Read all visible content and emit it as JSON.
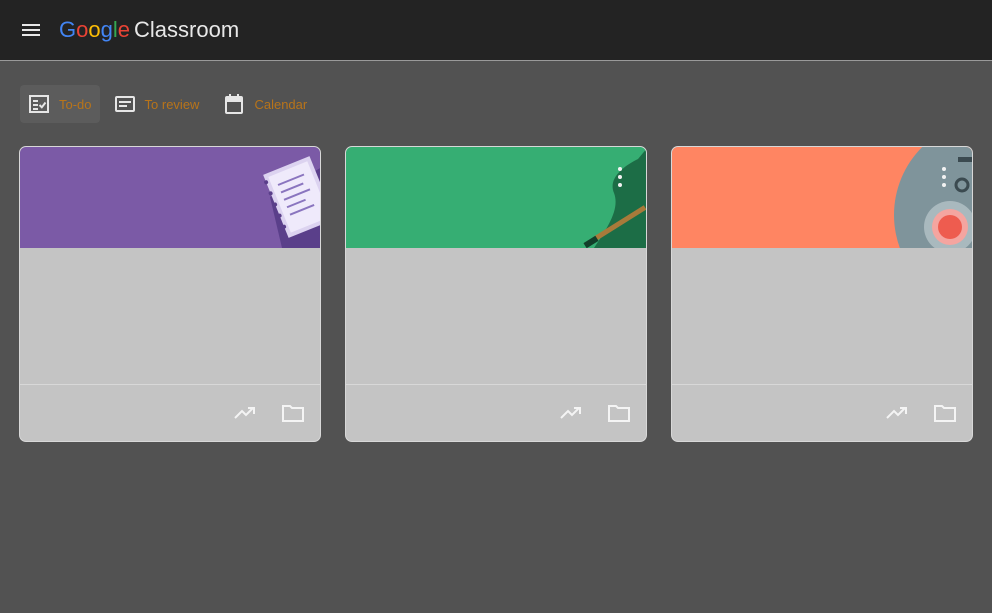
{
  "header": {
    "menu_icon": "hamburger-menu-icon",
    "brand": {
      "google_letters": [
        {
          "char": "G",
          "color": "#4285f4"
        },
        {
          "char": "o",
          "color": "#ea4335"
        },
        {
          "char": "o",
          "color": "#fbbc05"
        },
        {
          "char": "g",
          "color": "#4285f4"
        },
        {
          "char": "l",
          "color": "#34a853"
        },
        {
          "char": "e",
          "color": "#ea4335"
        }
      ],
      "product": "Classroom"
    }
  },
  "toolbar": {
    "todo_label": "To-do",
    "review_label": "To review",
    "calendar_label": "Calendar",
    "accent_color": "#b8741a"
  },
  "cards": [
    {
      "title": "",
      "subtitle": "",
      "banner_color": "#7b5aa6",
      "actions": [
        "trending-up-icon",
        "folder-icon"
      ]
    },
    {
      "title": "",
      "subtitle": "",
      "banner_color": "#36ae73",
      "actions": [
        "trending-up-icon",
        "folder-icon"
      ]
    },
    {
      "title": "",
      "subtitle": "",
      "banner_color": "#ff8562",
      "actions": [
        "trending-up-icon",
        "folder-icon"
      ]
    }
  ]
}
